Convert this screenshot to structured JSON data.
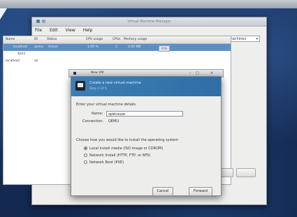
{
  "window": {
    "title": "Virtual Machine Manager",
    "menu": [
      "File",
      "Edit",
      "View",
      "Help"
    ],
    "filter": "Show: All virtual machines"
  },
  "table": {
    "columns": [
      "Name",
      "ID",
      "Status",
      "CPU usage",
      "CPUs",
      "Memory usage"
    ],
    "rows": [
      {
        "name": "localhost",
        "id": "qemu",
        "status": "Active",
        "cpu": "1.00 %",
        "cpus": "2",
        "mem": "0.00 MB",
        "badge": "0 %"
      },
      {
        "name": "Xen1",
        "id": "",
        "status": "",
        "cpu": "",
        "cpus": "",
        "mem": "",
        "badge": ""
      },
      {
        "name": "localhost",
        "id": "xe",
        "status": "",
        "cpu": "",
        "cpus": "",
        "mem": "",
        "badge": ""
      }
    ]
  },
  "behind_window": {
    "title": "New VM"
  },
  "dialog": {
    "banner_title": "Create a new virtual machine",
    "banner_step": "Step 1 of 5",
    "details_label": "Enter your virtual machine details",
    "name_label": "Name:",
    "name_value": "opensuse",
    "connection_label": "Connection:",
    "connection_value": "QEMU",
    "install_question": "Choose how you would like to install the operating system",
    "options": [
      "Local install media (ISO image or CDROM)",
      "Network Install (HTTP, FTP, or NFS)",
      "Network Boot (PXE)"
    ],
    "selected_option": 0,
    "cancel_label": "Cancel",
    "forward_label": "Forward"
  },
  "colors": {
    "selection": "#5c8ec6",
    "banner": "#3c7fb4"
  }
}
